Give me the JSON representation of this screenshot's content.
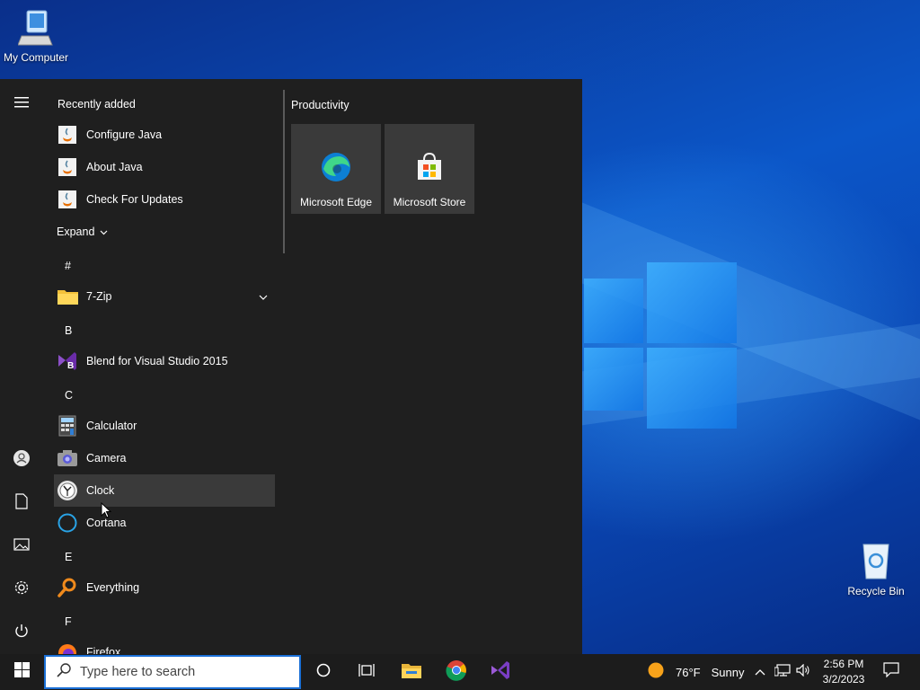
{
  "desktop": {
    "icons": [
      {
        "label": "My Computer"
      },
      {
        "label": "Recycle Bin"
      }
    ]
  },
  "start_menu": {
    "recently_added_label": "Recently added",
    "recent_apps": [
      "Configure Java",
      "About Java",
      "Check For Updates"
    ],
    "expand_label": "Expand",
    "groups": [
      {
        "letter": "#",
        "apps": [
          {
            "name": "7-Zip",
            "icon": "folder-icon",
            "has_chevron": true
          }
        ]
      },
      {
        "letter": "B",
        "apps": [
          {
            "name": "Blend for Visual Studio 2015",
            "icon": "blend-icon"
          }
        ]
      },
      {
        "letter": "C",
        "apps": [
          {
            "name": "Calculator",
            "icon": "calculator-icon"
          },
          {
            "name": "Camera",
            "icon": "camera-icon"
          },
          {
            "name": "Clock",
            "icon": "clock-icon",
            "hovered": true
          },
          {
            "name": "Cortana",
            "icon": "cortana-icon"
          }
        ]
      },
      {
        "letter": "E",
        "apps": [
          {
            "name": "Everything",
            "icon": "everything-icon"
          }
        ]
      },
      {
        "letter": "F",
        "apps": [
          {
            "name": "Firefox",
            "icon": "firefox-icon"
          }
        ]
      }
    ],
    "tiles_group_label": "Productivity",
    "tiles": [
      {
        "label": "Microsoft Edge",
        "icon": "edge-icon"
      },
      {
        "label": "Microsoft Store",
        "icon": "store-icon"
      }
    ],
    "rail": [
      "hamburger-icon",
      "user-icon",
      "documents-icon",
      "pictures-icon",
      "settings-icon",
      "power-icon"
    ]
  },
  "taskbar": {
    "search_placeholder": "Type here to search",
    "pinned": [
      "cortana-circle-icon",
      "task-view-icon",
      "file-explorer-icon",
      "chrome-icon",
      "visual-studio-icon"
    ],
    "weather": {
      "temp": "76°F",
      "condition": "Sunny"
    },
    "time": "2:56 PM",
    "date": "3/2/2023"
  },
  "colors": {
    "start_bg": "#1f1f1f",
    "tile_bg": "#3a3a3a",
    "taskbar_bg": "#1c1c1c",
    "accent": "#1a6fd6"
  }
}
